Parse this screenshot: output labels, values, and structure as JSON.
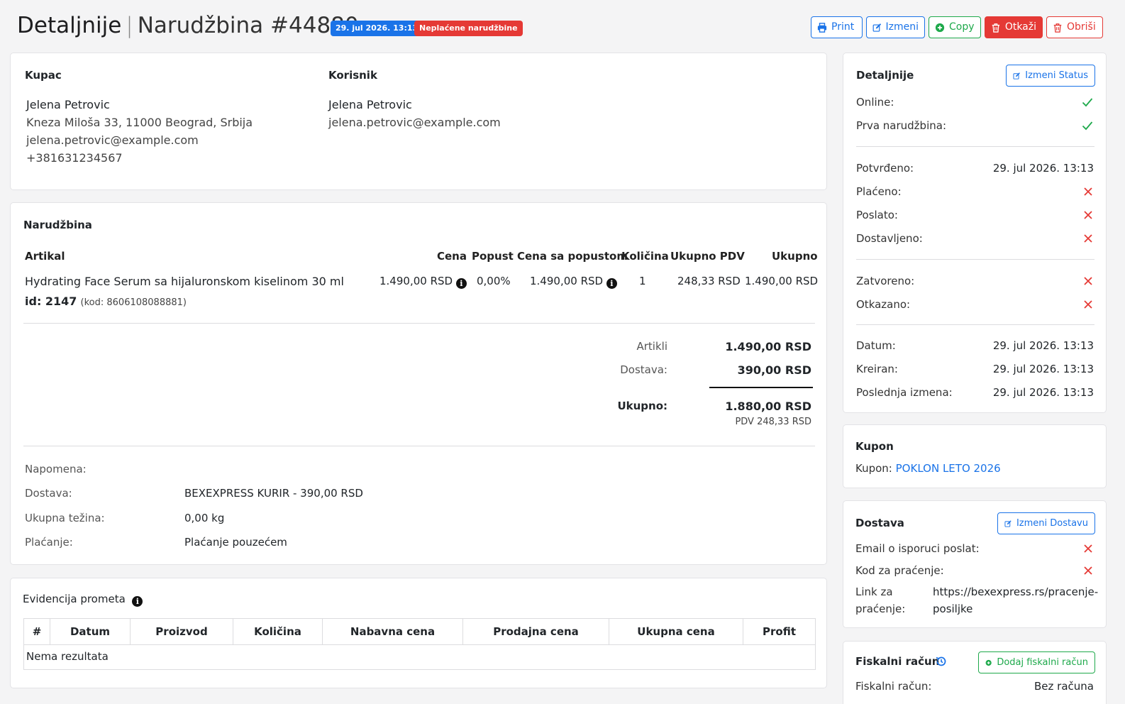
{
  "header": {
    "title": "Detaljnije",
    "separator": "|",
    "order": "Narudžbina #44880",
    "date_badge": "29. jul 2026. 13:13",
    "status_badge": "Neplaćene narudžbine",
    "buttons": {
      "print": "Print",
      "edit": "Izmeni",
      "copy": "Copy",
      "cancel": "Otkaži",
      "delete": "Obriši"
    }
  },
  "customer": {
    "heading": "Kupac",
    "name": "Jelena Petrovic",
    "address": "Kneza Miloša 33, 11000 Beograd, Srbija",
    "email": "jelena.petrovic@example.com",
    "phone": "+381631234567"
  },
  "user": {
    "heading": "Korisnik",
    "name": "Jelena Petrovic",
    "email": "jelena.petrovic@example.com"
  },
  "order": {
    "heading": "Narudžbina",
    "columns": [
      "Artikal",
      "Cena",
      "Popust",
      "Cena sa popustom",
      "Količina",
      "Ukupno PDV",
      "Ukupno"
    ],
    "item": {
      "name": "Hydrating Face Serum sa hijaluronskom kiselinom 30 ml",
      "id_label": "id: 2147",
      "code": "(kod: 8606108088881)",
      "price": "1.490,00 RSD",
      "discount": "0,00%",
      "discounted_price": "1.490,00 RSD",
      "quantity": "1",
      "vat_total": "248,33 RSD",
      "total": "1.490,00 RSD"
    },
    "summary": {
      "items_label": "Artikli",
      "items_value": "1.490,00 RSD",
      "shipping_label": "Dostava:",
      "shipping_value": "390,00 RSD",
      "total_label": "Ukupno:",
      "total_value": "1.880,00 RSD",
      "vat_note": "PDV 248,33 RSD"
    },
    "details": {
      "note_label": "Napomena:",
      "shipping_label": "Dostava:",
      "shipping_value": "BEXEXPRESS KURIR - 390,00 RSD",
      "weight_label": "Ukupna težina:",
      "weight_value": "0,00 kg",
      "payment_label": "Plaćanje:",
      "payment_value": "Plaćanje pouzećem"
    }
  },
  "turnover": {
    "heading": "Evidencija prometa",
    "columns": [
      "#",
      "Datum",
      "Proizvod",
      "Količina",
      "Nabavna cena",
      "Prodajna cena",
      "Ukupna cena",
      "Profit"
    ],
    "empty": "Nema rezultata"
  },
  "details_panel": {
    "heading": "Detaljnije",
    "edit_status": "Izmeni Status",
    "online": "Online:",
    "first_order": "Prva narudžbina:",
    "confirmed": "Potvrđeno:",
    "confirmed_value": "29. jul 2026. 13:13",
    "paid": "Plaćeno:",
    "sent": "Poslato:",
    "delivered": "Dostavljeno:",
    "closed": "Zatvoreno:",
    "cancelled": "Otkazano:",
    "date": "Datum:",
    "date_value": "29. jul 2026. 13:13",
    "created": "Kreiran:",
    "created_value": "29. jul 2026. 13:13",
    "last_edit": "Poslednja izmena:",
    "last_edit_value": "29. jul 2026. 13:13"
  },
  "coupon": {
    "heading": "Kupon",
    "label": "Kupon:",
    "value": "POKLON LETO 2026"
  },
  "delivery": {
    "heading": "Dostava",
    "edit": "Izmeni Dostavu",
    "email_sent": "Email o isporuci poslat:",
    "tracking_code": "Kod za praćenje:",
    "tracking_link_label_1": "Link za",
    "tracking_link_label_2": "praćenje:",
    "tracking_link_1": "https://bexexpress.rs/pracenje-",
    "tracking_link_2": "posiljke"
  },
  "fiscal": {
    "heading": "Fiskalni račun",
    "add": "Dodaj fiskalni račun",
    "label": "Fiskalni račun:",
    "value": "Bez računa"
  },
  "colors": {
    "blue": "#1a73e8",
    "green": "#1ea94b",
    "red": "#e53935"
  }
}
